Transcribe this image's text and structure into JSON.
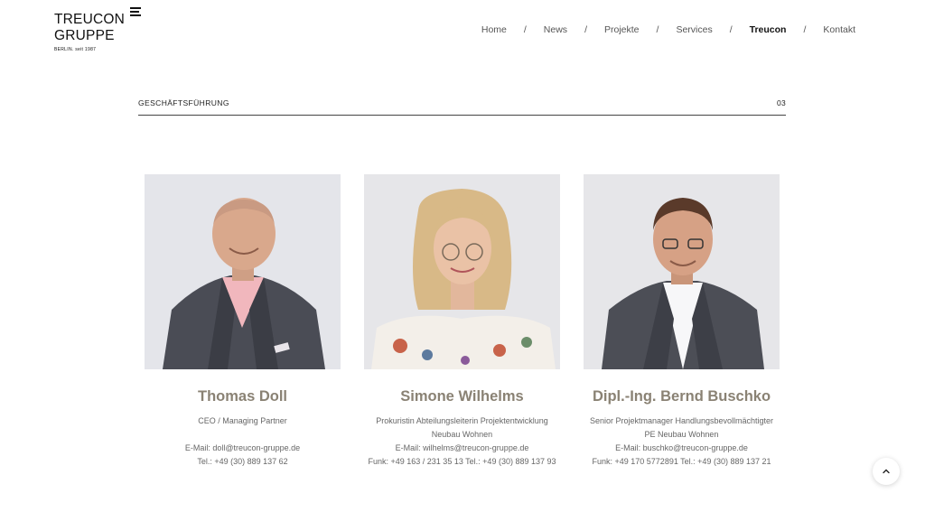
{
  "logo": {
    "line1": "TREUCON",
    "line2": "GRUPPE",
    "tagline": "BERLIN. seit 1987"
  },
  "nav": {
    "items": [
      {
        "label": "Home",
        "active": false
      },
      {
        "label": "News",
        "active": false
      },
      {
        "label": "Projekte",
        "active": false
      },
      {
        "label": "Services",
        "active": false
      },
      {
        "label": "Treucon",
        "active": true
      },
      {
        "label": "Kontakt",
        "active": false
      }
    ],
    "separator": "/"
  },
  "section": {
    "title": "GESCHÄFTSFÜHRUNG",
    "number": "03"
  },
  "people": [
    {
      "name": "Thomas Doll",
      "role": "CEO / Managing Partner",
      "email": "E-Mail: doll@treucon-gruppe.de",
      "phone": "Tel.: +49 (30) 889 137 62"
    },
    {
      "name": "Simone Wilhelms",
      "role": "Prokuristin Abteilungsleiterin Projektentwicklung Neubau Wohnen",
      "email": "E-Mail: wilhelms@treucon-gruppe.de",
      "phone": "Funk: +49 163 / 231 35 13 Tel.: +49 (30) 889 137 93"
    },
    {
      "name": "Dipl.-Ing. Bernd Buschko",
      "role": "Senior Projektmanager Handlungsbevollmächtigter PE Neubau Wohnen",
      "email": "E-Mail: buschko@treucon-gruppe.de",
      "phone": "Funk: +49 170 5772891 Tel.: +49 (30) 889 137 21"
    }
  ],
  "colors": {
    "name_accent": "#8a8274",
    "photo_background": "#e6e6e9"
  },
  "icons": {
    "scroll_top": "chevron-up-icon"
  }
}
